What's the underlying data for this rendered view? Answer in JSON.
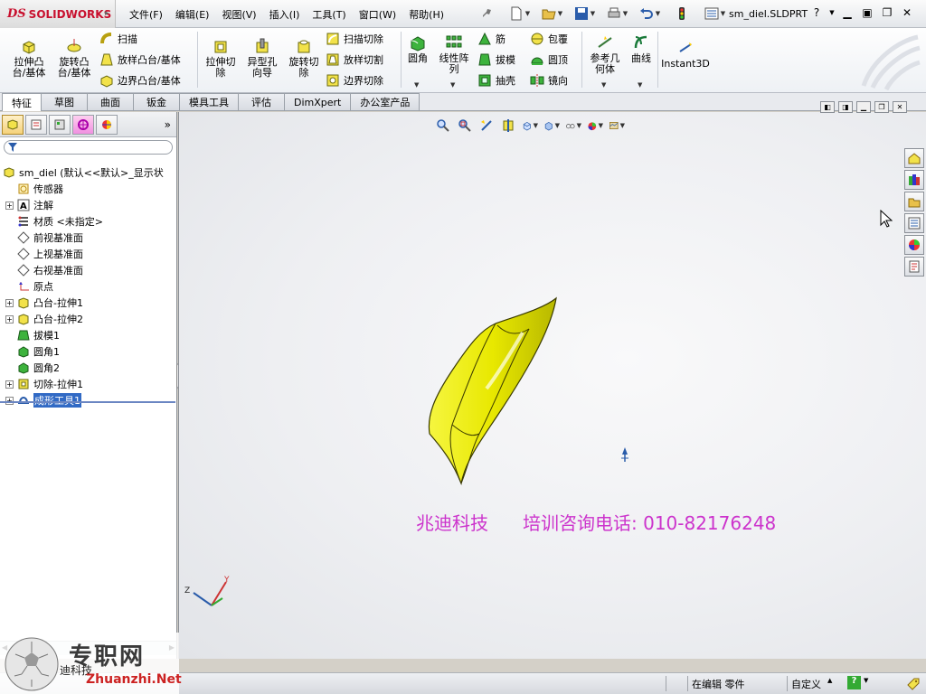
{
  "app": {
    "logo_ds": "DS",
    "logo_text": "SOLIDWORKS",
    "filename": "sm_diel.SLDPRT"
  },
  "menu": [
    "文件(F)",
    "编辑(E)",
    "视图(V)",
    "插入(I)",
    "工具(T)",
    "窗口(W)",
    "帮助(H)"
  ],
  "ribbon": {
    "extrude_boss": "拉伸凸\n台/基体",
    "revolve_boss": "旋转凸\n台/基体",
    "sweep": "扫描",
    "loft_boss": "放样凸台/基体",
    "boundary_boss": "边界凸台/基体",
    "extrude_cut": "拉伸切\n除",
    "hole_wizard": "异型孔\n向导",
    "revolve_cut": "旋转切\n除",
    "sweep_cut": "扫描切除",
    "loft_cut": "放样切割",
    "boundary_cut": "边界切除",
    "fillet": "圆角",
    "linear_pattern": "线性阵\n列",
    "rib": "筋",
    "draft": "拔模",
    "shell": "抽壳",
    "wrap": "包覆",
    "dome": "圆顶",
    "mirror": "镜向",
    "ref_geometry": "参考几\n何体",
    "curves": "曲线",
    "instant3d": "Instant3D"
  },
  "tabs": [
    "特征",
    "草图",
    "曲面",
    "钣金",
    "模具工具",
    "评估",
    "DimXpert",
    "办公室产品"
  ],
  "tree": {
    "root": "sm_diel  (默认<<默认>_显示状",
    "items": [
      {
        "label": "传感器",
        "expand": false
      },
      {
        "label": "注解",
        "expand": true
      },
      {
        "label": "材质 <未指定>",
        "expand": false
      },
      {
        "label": "前视基准面",
        "expand": false
      },
      {
        "label": "上视基准面",
        "expand": false
      },
      {
        "label": "右视基准面",
        "expand": false
      },
      {
        "label": "原点",
        "expand": false
      },
      {
        "label": "凸台-拉伸1",
        "expand": true
      },
      {
        "label": "凸台-拉伸2",
        "expand": true
      },
      {
        "label": "拔模1",
        "expand": false
      },
      {
        "label": "圆角1",
        "expand": false
      },
      {
        "label": "圆角2",
        "expand": false
      },
      {
        "label": "切除-拉伸1",
        "expand": true
      },
      {
        "label": "成形工具1",
        "expand": true
      }
    ]
  },
  "viewport": {
    "watermark_company": "兆迪科技",
    "watermark_phone": "培训咨询电话: 010-82176248"
  },
  "status": {
    "editing": "在编辑 零件",
    "custom": "自定义"
  },
  "overlay": {
    "site_cn": "专职网",
    "site_sub": "迪科技",
    "site_url": "Zhuanzhi.Net"
  },
  "colors": {
    "accent_red": "#c8102e",
    "part_yellow": "#e8e800",
    "watermark_magenta": "#cc33cc"
  }
}
